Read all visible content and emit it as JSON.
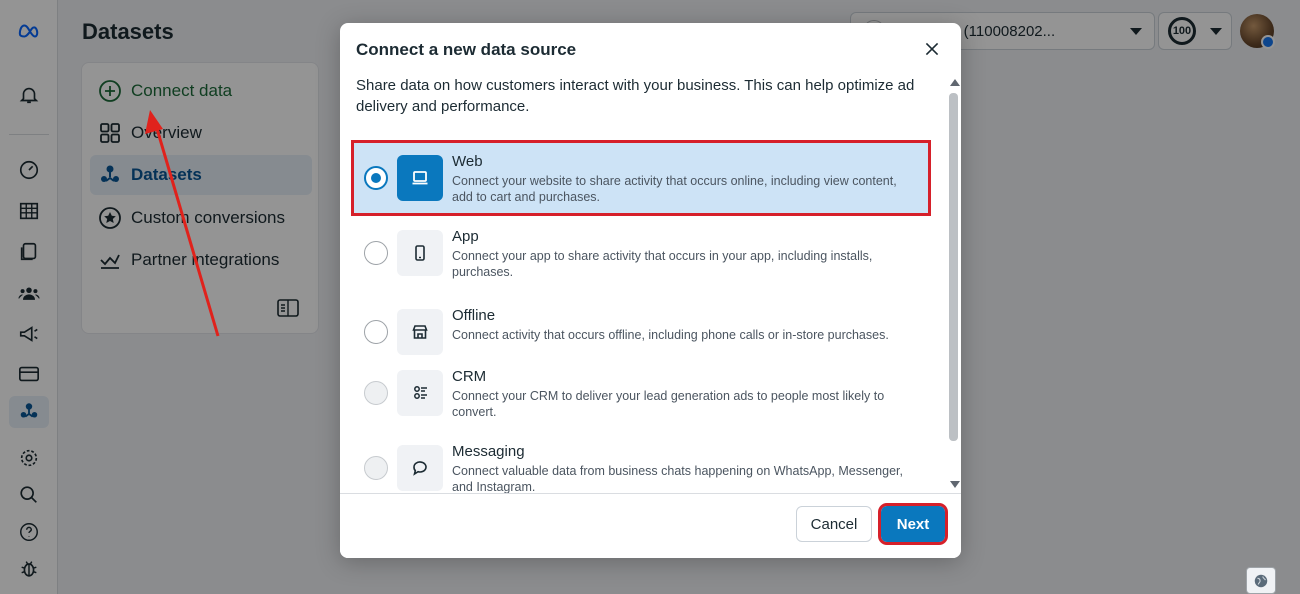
{
  "header": {
    "page_title": "Datasets",
    "account_label": "81110006 (110008202...",
    "score_label": "100"
  },
  "sidebar": {
    "items": [
      {
        "label": "Connect data",
        "icon": "plus-circle-icon"
      },
      {
        "label": "Overview",
        "icon": "grid-icon"
      },
      {
        "label": "Datasets",
        "icon": "datasets-icon"
      },
      {
        "label": "Custom conversions",
        "icon": "star-circle-icon"
      },
      {
        "label": "Partner integrations",
        "icon": "integrations-icon"
      }
    ]
  },
  "rail": {
    "icons": [
      "meta-logo-icon",
      "bell-icon",
      "gauge-icon",
      "table-icon",
      "pages-icon",
      "people-icon",
      "megaphone-icon",
      "billing-card-icon",
      "datasets-icon",
      "gear-icon",
      "search-icon",
      "help-icon",
      "bug-icon"
    ]
  },
  "dialog": {
    "title": "Connect a new data source",
    "description": "Share data on how customers interact with your business. This can help optimize ad delivery and performance.",
    "options": [
      {
        "title": "Web",
        "description": "Connect your website to share activity that occurs online, including view content, add to cart and purchases.",
        "icon": "laptop-icon",
        "selected": true
      },
      {
        "title": "App",
        "description": "Connect your app to share activity that occurs in your app, including installs, purchases.",
        "icon": "phone-icon",
        "selected": false
      },
      {
        "title": "Offline",
        "description": "Connect activity that occurs offline, including phone calls or in-store purchases.",
        "icon": "store-icon",
        "selected": false
      },
      {
        "title": "CRM",
        "description": "Connect your CRM to deliver your lead generation ads to people most likely to convert.",
        "icon": "crm-icon",
        "selected": false
      },
      {
        "title": "Messaging",
        "description": "Connect valuable data from business chats happening on WhatsApp, Messenger, and Instagram.",
        "icon": "chat-icon",
        "selected": false
      }
    ],
    "cancel_label": "Cancel",
    "next_label": "Next"
  },
  "colors": {
    "accent": "#0a78be",
    "highlight": "#d6202a",
    "connect_green": "#1d6b3a",
    "selected_bg": "#cde3f6"
  }
}
